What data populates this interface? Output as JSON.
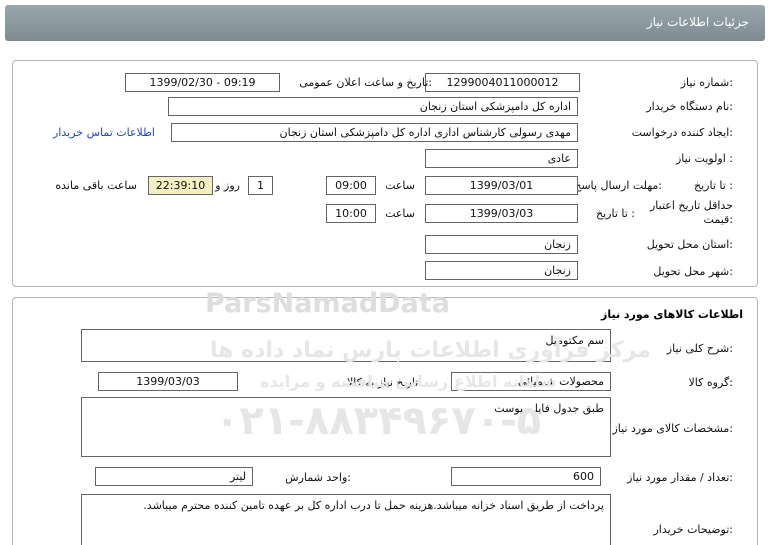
{
  "header": {
    "title": "جزئیات اطلاعات نیاز"
  },
  "need_info": {
    "need_number_label": "شماره نیاز:",
    "need_number": "1299004011000012",
    "announce_label": "تاریخ و ساعت اعلان عمومی:",
    "announce_value": "1399/02/30 - 09:19",
    "buyer_org_label": "نام دستگاه خریدار:",
    "buyer_org": "اداره کل دامپزشکی استان زنجان",
    "creator_label": "ایجاد کننده درخواست:",
    "creator": "مهدی رسولی کارشناس اداری  اداره کل دامپزشکی استان زنجان",
    "contact_link": "اطلاعات تماس خریدار",
    "priority_label": "اولویت نیاز :",
    "priority": "عادی",
    "reply_deadline_label": "مهلت ارسال پاسخ:",
    "to_date_label": "تا تاریخ :",
    "reply_date": "1399/03/01",
    "time_label": "ساعت",
    "reply_time": "09:00",
    "days_value": "1",
    "days_label": "روز و",
    "remaining_time": "22:39:10",
    "remaining_label": "ساعت باقی مانده",
    "validity_label_1": "حداقل تاریخ اعتبار",
    "validity_label_2": "قیمت:",
    "validity_to_label": "تا تاریخ :",
    "validity_date": "1399/03/03",
    "validity_time_label": "ساعت",
    "validity_time": "10:00",
    "province_label": "استان محل تحویل:",
    "province": "زنجان",
    "city_label": "شهر محل تحویل:",
    "city": "زنجان"
  },
  "goods": {
    "section_title": "اطلاعات کالاهای مورد نیاز",
    "summary_label": "شرح کلی نیاز:",
    "summary": "سم مکتومیل",
    "group_label": "گروه کالا:",
    "group": "محصولات شیمیائی",
    "need_date_label": "تاریخ نیاز به کالا:",
    "need_date": "1399/03/03",
    "specs_label": "مشخصات کالای مورد نیاز:",
    "specs": "طبق جدول فایل پیوست",
    "qty_label": "تعداد / مقدار مورد نیاز:",
    "qty": "600",
    "unit_label": "واحد شمارش:",
    "unit": "لیتر",
    "buyer_notes_label": "توضیحات خریدار:",
    "buyer_notes": "پرداخت از طریق اسناد خزانه میباشد.هزینه حمل تا درب اداره کل بر عهده تامین کننده محترم میباشد."
  },
  "watermark": {
    "brand": "ParsNamadData",
    "line1": "مرکز فرآوری اطلاعات پارس نماد داده ها",
    "line2": "سامانه اطلاع رسانی مناقصه و مزایده",
    "phone": "۰۲۱-۸۸۳۴۹۶۷۰-۵"
  },
  "colors": {
    "title_bar": "#8a969d",
    "link": "#2244cc",
    "highlight": "#f4efc2"
  }
}
